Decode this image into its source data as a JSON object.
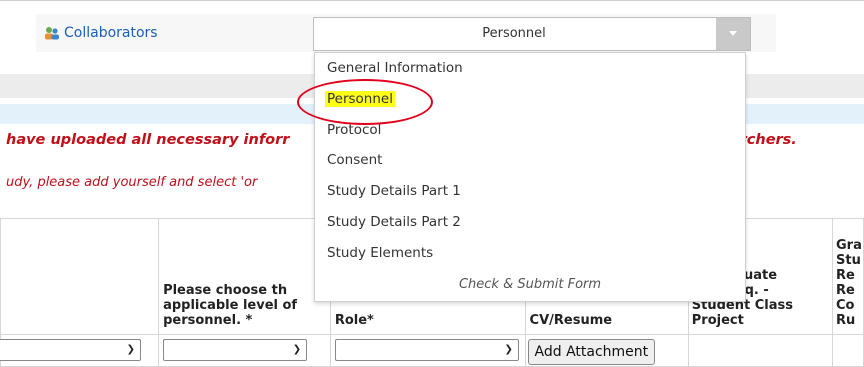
{
  "header": {
    "collaborators_link": "Collaborators",
    "section_select": {
      "value": "Personnel"
    }
  },
  "messages": {
    "warning_left": "have uploaded all necessary inforr",
    "warning_right": "earchers.",
    "note": "udy, please add yourself and select 'or"
  },
  "table": {
    "headers": {
      "level": "Please choose the applicable level of personnel. *",
      "level_lines": [
        "Please choose th",
        "applicable level of",
        "personnel. *"
      ],
      "role": "Role*",
      "cv": "CV/Resume",
      "undergrad_lines": [
        "rgraduate",
        "Req. -",
        "Student Class",
        "Project"
      ],
      "grad_lines": [
        "Gra",
        "Stu",
        "Re",
        "Re",
        "Co",
        "Ru"
      ]
    },
    "attach_button": "Add Attachment"
  },
  "dropdown": {
    "options": [
      "General Information",
      "Personnel",
      "Protocol",
      "Consent",
      "Study Details Part 1",
      "Study Details Part 2",
      "Study Elements"
    ],
    "highlighted": "Personnel",
    "footer": "Check & Submit Form"
  },
  "colors": {
    "warning": "#c0101a",
    "link": "#1a5fb4",
    "highlight": "#ffff1a",
    "circle": "#e0001b",
    "info_band": "#e3f1fb"
  }
}
